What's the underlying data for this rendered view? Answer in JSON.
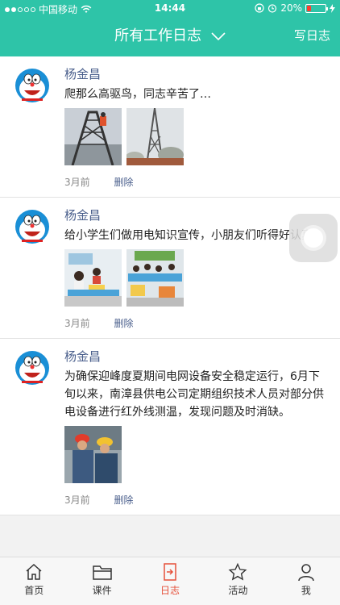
{
  "status_bar": {
    "carrier": "中国移动",
    "time": "14:44",
    "battery": "20%",
    "battery_level": 0.2
  },
  "header": {
    "title": "所有工作日志",
    "right_button": "写日志"
  },
  "posts": [
    {
      "author": "杨金昌",
      "text": "爬那么高驱鸟，同志辛苦了…",
      "time": "3月前",
      "delete_label": "删除"
    },
    {
      "author": "杨金昌",
      "text": "给小学生们做用电知识宣传，小朋友们听得好认真。",
      "time": "3月前",
      "delete_label": "删除"
    },
    {
      "author": "杨金昌",
      "text": "为确保迎峰度夏期间电网设备安全稳定运行，6月下旬以来，南漳县供电公司定期组织技术人员对部分供电设备进行红外线测温，发现问题及时消缺。",
      "time": "3月前",
      "delete_label": "删除"
    }
  ],
  "tabs": [
    {
      "label": "首页",
      "icon": "home-icon"
    },
    {
      "label": "课件",
      "icon": "folder-icon"
    },
    {
      "label": "日志",
      "icon": "log-icon",
      "active": true
    },
    {
      "label": "活动",
      "icon": "star-icon"
    },
    {
      "label": "我",
      "icon": "person-icon"
    }
  ],
  "colors": {
    "header": "#2ec4a8",
    "active_tab": "#e6503a",
    "author": "#4a5f8c"
  }
}
